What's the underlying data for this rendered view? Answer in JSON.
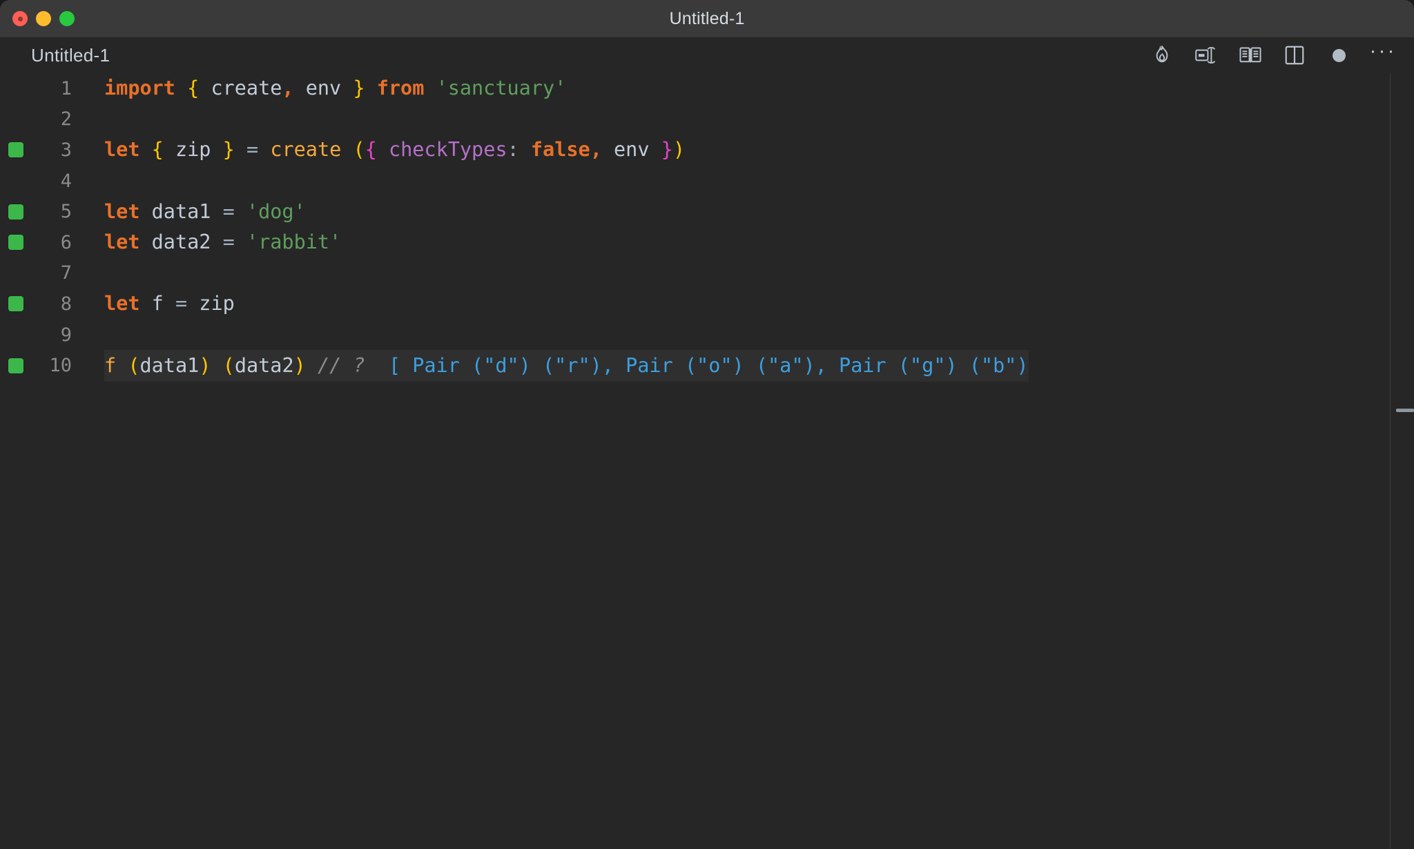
{
  "window": {
    "title": "Untitled-1",
    "traffic_lights": [
      "close",
      "minimize",
      "zoom"
    ]
  },
  "tabbar": {
    "tab_label": "Untitled-1",
    "icons": [
      {
        "name": "quokka-flame-icon",
        "label": "Quokka"
      },
      {
        "name": "run-code-icon",
        "label": "Run"
      },
      {
        "name": "open-preview-icon",
        "label": "Open Preview"
      },
      {
        "name": "split-editor-icon",
        "label": "Split Editor"
      },
      {
        "name": "unsaved-dot-icon",
        "label": "Unsaved changes"
      },
      {
        "name": "more-actions-icon",
        "label": "…"
      }
    ],
    "ellipsis": "···"
  },
  "editor": {
    "language": "javascript",
    "lines": [
      {
        "number": "1",
        "marker": false,
        "active": false,
        "tokens": [
          {
            "t": "import",
            "c": "t-keyword"
          },
          {
            "t": " ",
            "c": "t-plain"
          },
          {
            "t": "{",
            "c": "t-brace"
          },
          {
            "t": " create",
            "c": "t-plain"
          },
          {
            "t": ",",
            "c": "t-keyword"
          },
          {
            "t": " env ",
            "c": "t-plain"
          },
          {
            "t": "}",
            "c": "t-brace"
          },
          {
            "t": " ",
            "c": "t-plain"
          },
          {
            "t": "from",
            "c": "t-keyword"
          },
          {
            "t": " ",
            "c": "t-plain"
          },
          {
            "t": "'sanctuary'",
            "c": "t-string"
          }
        ]
      },
      {
        "number": "2",
        "marker": false,
        "active": false,
        "tokens": []
      },
      {
        "number": "3",
        "marker": true,
        "active": false,
        "tokens": [
          {
            "t": "let",
            "c": "t-keyword"
          },
          {
            "t": " ",
            "c": "t-plain"
          },
          {
            "t": "{",
            "c": "t-brace"
          },
          {
            "t": " zip ",
            "c": "t-plain"
          },
          {
            "t": "}",
            "c": "t-brace"
          },
          {
            "t": " ",
            "c": "t-plain"
          },
          {
            "t": "=",
            "c": "t-op"
          },
          {
            "t": " ",
            "c": "t-plain"
          },
          {
            "t": "create",
            "c": "t-func"
          },
          {
            "t": " ",
            "c": "t-plain"
          },
          {
            "t": "(",
            "c": "t-paren"
          },
          {
            "t": "{",
            "c": "t-brace2"
          },
          {
            "t": " ",
            "c": "t-plain"
          },
          {
            "t": "checkTypes",
            "c": "t-prop"
          },
          {
            "t": ":",
            "c": "t-op"
          },
          {
            "t": " ",
            "c": "t-plain"
          },
          {
            "t": "false",
            "c": "t-keyword"
          },
          {
            "t": ",",
            "c": "t-keyword"
          },
          {
            "t": " env ",
            "c": "t-plain"
          },
          {
            "t": "}",
            "c": "t-brace2"
          },
          {
            "t": ")",
            "c": "t-paren"
          }
        ]
      },
      {
        "number": "4",
        "marker": false,
        "active": false,
        "tokens": []
      },
      {
        "number": "5",
        "marker": true,
        "active": false,
        "tokens": [
          {
            "t": "let",
            "c": "t-keyword"
          },
          {
            "t": " data1 ",
            "c": "t-plain"
          },
          {
            "t": "=",
            "c": "t-op"
          },
          {
            "t": " ",
            "c": "t-plain"
          },
          {
            "t": "'dog'",
            "c": "t-string"
          }
        ]
      },
      {
        "number": "6",
        "marker": true,
        "active": false,
        "tokens": [
          {
            "t": "let",
            "c": "t-keyword"
          },
          {
            "t": " data2 ",
            "c": "t-plain"
          },
          {
            "t": "=",
            "c": "t-op"
          },
          {
            "t": " ",
            "c": "t-plain"
          },
          {
            "t": "'rabbit'",
            "c": "t-string"
          }
        ]
      },
      {
        "number": "7",
        "marker": false,
        "active": false,
        "tokens": []
      },
      {
        "number": "8",
        "marker": true,
        "active": false,
        "tokens": [
          {
            "t": "let",
            "c": "t-keyword"
          },
          {
            "t": " f ",
            "c": "t-plain"
          },
          {
            "t": "=",
            "c": "t-op"
          },
          {
            "t": " zip",
            "c": "t-plain"
          }
        ]
      },
      {
        "number": "9",
        "marker": false,
        "active": false,
        "tokens": []
      },
      {
        "number": "10",
        "marker": true,
        "active": true,
        "tokens": [
          {
            "t": "f",
            "c": "t-var"
          },
          {
            "t": " ",
            "c": "t-plain"
          },
          {
            "t": "(",
            "c": "t-paren"
          },
          {
            "t": "data1",
            "c": "t-plain"
          },
          {
            "t": ")",
            "c": "t-paren"
          },
          {
            "t": " ",
            "c": "t-plain"
          },
          {
            "t": "(",
            "c": "t-paren"
          },
          {
            "t": "data2",
            "c": "t-plain"
          },
          {
            "t": ")",
            "c": "t-paren"
          },
          {
            "t": " ",
            "c": "t-plain"
          },
          {
            "t": "// ?",
            "c": "t-comment"
          },
          {
            "t": "  ",
            "c": "t-plain"
          },
          {
            "t": "[ Pair (\"d\") (\"r\"), Pair (\"o\") (\"a\"), Pair (\"g\") (\"b\")",
            "c": "t-result"
          }
        ]
      }
    ],
    "inline_result_line_10": "[ Pair (\"d\") (\"r\"), Pair (\"o\") (\"a\"), Pair (\"g\") (\"b\")",
    "colors": {
      "background": "#262626",
      "titlebar": "#3a3a3a",
      "active_line": "#2f2f2f",
      "line_number": "#8a8a8a",
      "keyword": "#e8712a",
      "string": "#5f9e5f",
      "brace_yellow": "#ffc600",
      "brace_magenta": "#e945c6",
      "property": "#b471c9",
      "function": "#f5a93c",
      "comment": "#8c8c8c",
      "result": "#3d9fe0",
      "marker_green": "#3cb84a",
      "text": "#c3ccd8"
    }
  }
}
